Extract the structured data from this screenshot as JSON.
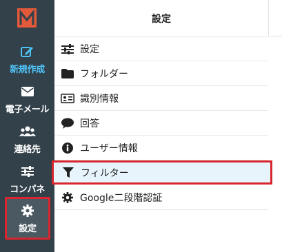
{
  "header": {
    "title": "設定"
  },
  "sidebar": {
    "items": [
      {
        "label": "新規作成",
        "icon": "edit-icon"
      },
      {
        "label": "電子メール",
        "icon": "envelope-icon"
      },
      {
        "label": "連絡先",
        "icon": "users-icon"
      },
      {
        "label": "コンパネ",
        "icon": "sliders-icon"
      },
      {
        "label": "設定",
        "icon": "gear-icon",
        "selected": true
      }
    ]
  },
  "menu": {
    "items": [
      {
        "label": "設定",
        "icon": "sliders-icon"
      },
      {
        "label": "フォルダー",
        "icon": "folder-icon"
      },
      {
        "label": "識別情報",
        "icon": "id-card-icon"
      },
      {
        "label": "回答",
        "icon": "speech-bubble-icon"
      },
      {
        "label": "ユーザー情報",
        "icon": "info-icon"
      },
      {
        "label": "フィルター",
        "icon": "filter-icon",
        "selected": true
      },
      {
        "label": "Google二段階認証",
        "icon": "gear-icon"
      }
    ]
  },
  "colors": {
    "sidebar_bg": "#33414a",
    "accent_blue": "#4fc3f7",
    "highlight_red": "#d9262e",
    "logo_orange": "#e2593b",
    "active_row_bg": "#e8f4fb"
  }
}
